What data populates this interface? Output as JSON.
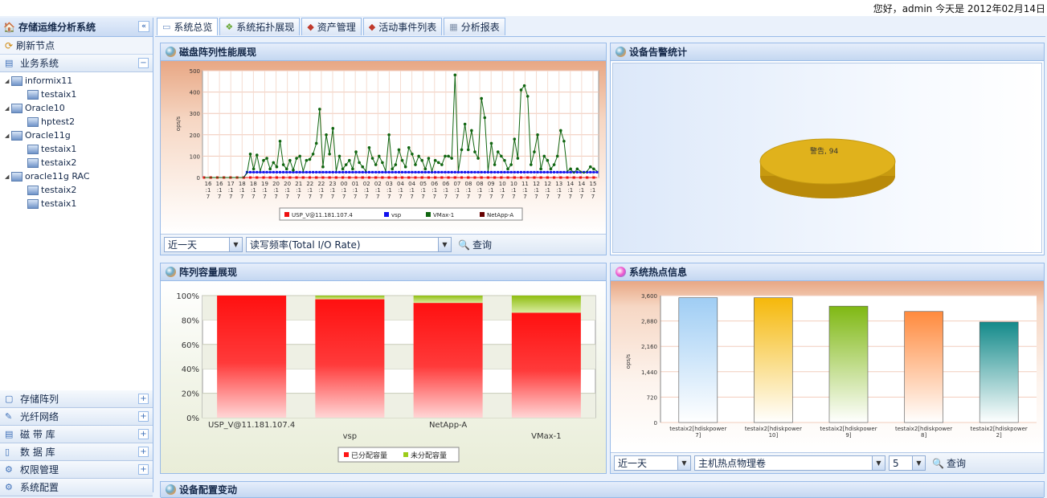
{
  "header": {
    "greeting": "您好，admin 今天是 2012年02月14日"
  },
  "sidebar": {
    "title": "存储运维分析系统",
    "collapse_glyph": "«",
    "refresh_label": "刷新节点",
    "business_label": "业务系统",
    "tree": [
      {
        "label": "informix11",
        "children": [
          "testaix1"
        ]
      },
      {
        "label": "Oracle10",
        "children": [
          "hptest2"
        ]
      },
      {
        "label": "Oracle11g",
        "children": [
          "testaix1",
          "testaix2"
        ]
      },
      {
        "label": "oracle11g RAC",
        "children": [
          "testaix2",
          "testaix1"
        ]
      }
    ],
    "bottom_items": [
      {
        "label": "存储阵列",
        "icon": "array-icon"
      },
      {
        "label": "光纤网络",
        "icon": "fiber-icon"
      },
      {
        "label": "磁 带 库",
        "icon": "tape-icon"
      },
      {
        "label": "数 据 库",
        "icon": "database-icon"
      },
      {
        "label": "权限管理",
        "icon": "permission-icon"
      }
    ],
    "last_partial": "系统配置"
  },
  "tabs": [
    {
      "label": "系统总览",
      "icon": "overview-icon"
    },
    {
      "label": "系统拓扑展现",
      "icon": "topology-icon"
    },
    {
      "label": "资产管理",
      "icon": "asset-icon"
    },
    {
      "label": "活动事件列表",
      "icon": "event-icon"
    },
    {
      "label": "分析报表",
      "icon": "report-icon"
    }
  ],
  "panels": {
    "perf": {
      "title": "磁盘阵列性能展现",
      "period": "近一天",
      "metric": "读写频率(Total I/O Rate)",
      "query": "查询"
    },
    "alarm": {
      "title": "设备告警统计"
    },
    "capacity": {
      "title": "阵列容量展现"
    },
    "hot": {
      "title": "系统热点信息",
      "period": "近一天",
      "object": "主机热点物理卷",
      "count": "5",
      "query": "查询"
    },
    "bottom_partial": "设备配置变动"
  },
  "chart_data": [
    {
      "type": "line",
      "ylabel": "ops/s",
      "ylim": [
        0,
        500
      ],
      "yticks": [
        0,
        100,
        200,
        300,
        400,
        500
      ],
      "xticks": [
        "16:17",
        "16:17",
        "17:17",
        "18:17",
        "18:17",
        "19:17",
        "20:17",
        "20:17",
        "21:17",
        "22:17",
        "22:17",
        "23:17",
        "00:17",
        "01:17",
        "02:17",
        "02:17",
        "03:17",
        "04:17",
        "04:17",
        "05:17",
        "06:17",
        "06:17",
        "07:17",
        "08:17",
        "08:17",
        "09:17",
        "10:17",
        "10:17",
        "11:17",
        "12:17",
        "12:17",
        "13:17",
        "14:17",
        "14:17",
        "15:17"
      ],
      "series": [
        {
          "name": "USP_V@11.181.107.4",
          "color": "#ee1111",
          "values": [
            0,
            0,
            0,
            0,
            0,
            0,
            0,
            0,
            0,
            0,
            0,
            0,
            0,
            0,
            0,
            0,
            0,
            0,
            0,
            0,
            0,
            0,
            0,
            0,
            0,
            0,
            0,
            0,
            0,
            0,
            0,
            0,
            0,
            0,
            0,
            0,
            0,
            0,
            0,
            0,
            0,
            0,
            0,
            0,
            0,
            0,
            0,
            0,
            0,
            0,
            0,
            0,
            0,
            0,
            0,
            0,
            0,
            0,
            0,
            0,
            0,
            0,
            0,
            0,
            0,
            0,
            0,
            0,
            0,
            0,
            0,
            0,
            0,
            0,
            0,
            0,
            0,
            0,
            0,
            0,
            0,
            0,
            0,
            0,
            0,
            0,
            0,
            0,
            0,
            0,
            0,
            0,
            0,
            0,
            0,
            0,
            0,
            0,
            0,
            0,
            0,
            0,
            0,
            0,
            0,
            0,
            0,
            0,
            0,
            0,
            0,
            0,
            0,
            0,
            0,
            0,
            0,
            0,
            0,
            0
          ]
        },
        {
          "name": "vsp",
          "color": "#1111ee",
          "values": [
            0,
            0,
            0,
            0,
            0,
            0,
            0,
            0,
            0,
            0,
            0,
            0,
            0,
            25,
            25,
            25,
            25,
            25,
            25,
            25,
            25,
            25,
            25,
            25,
            25,
            25,
            25,
            25,
            25,
            25,
            25,
            25,
            25,
            25,
            25,
            25,
            25,
            25,
            25,
            25,
            25,
            25,
            25,
            25,
            25,
            25,
            25,
            25,
            25,
            25,
            25,
            25,
            25,
            25,
            25,
            25,
            25,
            25,
            25,
            25,
            25,
            25,
            25,
            25,
            25,
            25,
            25,
            25,
            25,
            25,
            25,
            25,
            25,
            25,
            25,
            25,
            25,
            25,
            25,
            25,
            25,
            25,
            25,
            25,
            25,
            25,
            25,
            25,
            25,
            25,
            25,
            25,
            25,
            25,
            25,
            25,
            25,
            25,
            25,
            25,
            25,
            25,
            25,
            25,
            25,
            25,
            25,
            25,
            25,
            25,
            25,
            25,
            25,
            25,
            25,
            25,
            25,
            25,
            25,
            25
          ]
        },
        {
          "name": "VMax-1",
          "color": "#116611",
          "values": [
            0,
            0,
            0,
            0,
            0,
            0,
            0,
            0,
            0,
            0,
            0,
            0,
            0,
            20,
            110,
            40,
            105,
            30,
            80,
            90,
            40,
            70,
            50,
            170,
            60,
            40,
            80,
            35,
            90,
            100,
            30,
            80,
            85,
            110,
            160,
            320,
            50,
            200,
            110,
            230,
            30,
            100,
            40,
            60,
            80,
            40,
            120,
            70,
            50,
            30,
            140,
            90,
            60,
            100,
            70,
            30,
            200,
            40,
            60,
            130,
            80,
            50,
            140,
            110,
            60,
            100,
            80,
            40,
            90,
            30,
            80,
            70,
            60,
            100,
            100,
            90,
            480,
            30,
            130,
            250,
            130,
            220,
            120,
            90,
            370,
            280,
            30,
            160,
            60,
            120,
            100,
            80,
            40,
            60,
            180,
            90,
            410,
            430,
            380,
            60,
            120,
            200,
            40,
            100,
            80,
            40,
            60,
            100,
            220,
            170,
            30,
            40,
            20,
            40,
            30,
            20,
            30,
            50,
            40,
            30
          ]
        },
        {
          "name": "NetApp-A",
          "color": "#660000",
          "values": [
            0,
            0,
            0,
            0,
            0,
            0,
            0,
            0,
            0,
            0,
            0,
            0,
            0,
            0,
            0,
            0,
            0,
            0,
            0,
            0,
            0,
            0,
            0,
            0,
            0,
            0,
            0,
            0,
            0,
            0,
            0,
            0,
            0,
            0,
            0,
            0,
            0,
            0,
            0,
            0,
            0,
            0,
            0,
            0,
            0,
            0,
            0,
            0,
            0,
            0,
            0,
            0,
            0,
            0,
            0,
            0,
            0,
            0,
            0,
            0,
            0,
            0,
            0,
            0,
            0,
            0,
            0,
            0,
            0,
            0,
            0,
            0,
            0,
            0,
            0,
            0,
            0,
            0,
            0,
            0,
            0,
            0,
            0,
            0,
            0,
            0,
            0,
            0,
            0,
            0,
            0,
            0,
            0,
            0,
            0,
            0,
            0,
            0,
            0,
            0,
            0,
            0,
            0,
            0,
            0,
            0,
            0,
            0,
            0,
            0,
            0,
            0,
            0,
            0,
            0,
            0,
            0,
            0,
            0,
            0
          ]
        }
      ]
    },
    {
      "type": "pie",
      "slices": [
        {
          "label": "警告",
          "value": 94
        }
      ],
      "label_text": "警告, 94",
      "color": "#e0b21c"
    },
    {
      "type": "bar",
      "stacked": true,
      "ylim": [
        0,
        100
      ],
      "yticks": [
        "0%",
        "20%",
        "40%",
        "60%",
        "80%",
        "100%"
      ],
      "categories": [
        "USP_V@11.181.107.4",
        "vsp",
        "NetApp-A",
        "VMax-1"
      ],
      "series": [
        {
          "name": "已分配容量",
          "color": "#ff1515",
          "values": [
            100,
            97,
            94,
            86
          ]
        },
        {
          "name": "未分配容量",
          "color": "#9ccc1a",
          "values": [
            0,
            3,
            6,
            14
          ]
        }
      ]
    },
    {
      "type": "bar",
      "ylabel": "ops/s",
      "ylim": [
        0,
        3600
      ],
      "yticks": [
        "0",
        "720",
        "1,440",
        "2,160",
        "2,880",
        "3,600"
      ],
      "categories": [
        "testaix2[hdiskpower7]",
        "testaix2[hdiskpower10]",
        "testaix2[hdiskpower9]",
        "testaix2[hdiskpower8]",
        "testaix2[hdiskpower2]"
      ],
      "category_lines": [
        [
          "testaix2[hdiskpower",
          "7]"
        ],
        [
          "testaix2[hdiskpower",
          "10]"
        ],
        [
          "testaix2[hdiskpower",
          "9]"
        ],
        [
          "testaix2[hdiskpower",
          "8]"
        ],
        [
          "testaix2[hdiskpower",
          "2]"
        ]
      ],
      "values": [
        3540,
        3540,
        3300,
        3150,
        2850
      ],
      "colors": [
        "#9fcdf4",
        "#f5b80a",
        "#7fb813",
        "#ff8a3d",
        "#138a8a"
      ]
    }
  ]
}
